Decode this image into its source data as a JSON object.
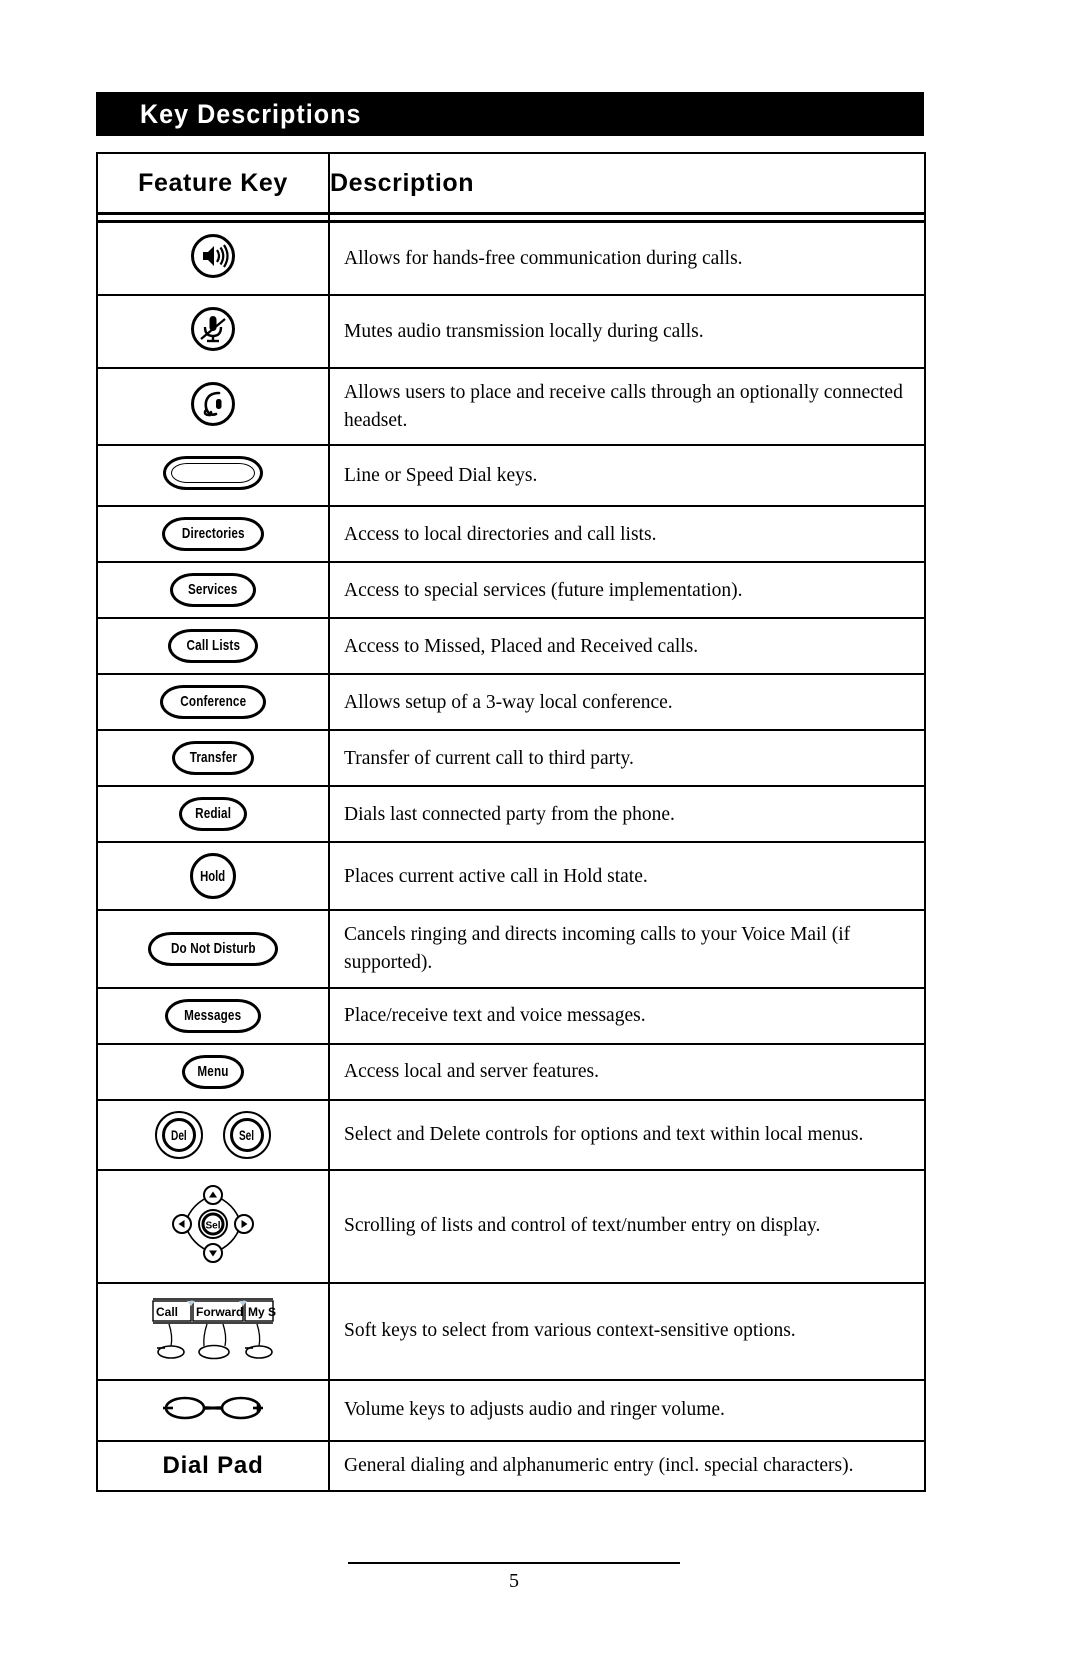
{
  "banner": {
    "title": "Key Descriptions"
  },
  "table": {
    "headers": {
      "feature_key": "Feature Key",
      "description": "Description"
    },
    "rows": [
      {
        "key_type": "icon",
        "icon": "speaker-icon",
        "key_label": "",
        "description": "Allows for hands-free communication during calls."
      },
      {
        "key_type": "icon",
        "icon": "mute-microphone-icon",
        "key_label": "",
        "description": "Mutes audio transmission locally during calls."
      },
      {
        "key_type": "icon",
        "icon": "headset-icon",
        "key_label": "",
        "description": "Allows users to place and receive calls through an optionally connected headset."
      },
      {
        "key_type": "blank-barrel",
        "icon": "line-key-icon",
        "key_label": "",
        "description": "Line or Speed Dial keys."
      },
      {
        "key_type": "barrel",
        "icon": "directories-key-icon",
        "key_label": "Directories",
        "description": "Access to local directories and call lists."
      },
      {
        "key_type": "barrel",
        "icon": "services-key-icon",
        "key_label": "Services",
        "description": "Access to special services (future implementation)."
      },
      {
        "key_type": "barrel",
        "icon": "call-lists-key-icon",
        "key_label": "Call Lists",
        "description": "Access to Missed, Placed and Received calls."
      },
      {
        "key_type": "barrel",
        "icon": "conference-key-icon",
        "key_label": "Conference",
        "description": "Allows setup of a 3-way local conference."
      },
      {
        "key_type": "barrel",
        "icon": "transfer-key-icon",
        "key_label": "Transfer",
        "description": "Transfer of current call to third party."
      },
      {
        "key_type": "barrel",
        "icon": "redial-key-icon",
        "key_label": "Redial",
        "description": "Dials last connected party from the phone."
      },
      {
        "key_type": "circle",
        "icon": "hold-key-icon",
        "key_label": "Hold",
        "description": "Places current active call in Hold state."
      },
      {
        "key_type": "barrel",
        "icon": "do-not-disturb-key-icon",
        "key_label": "Do Not Disturb",
        "description": "Cancels ringing and directs incoming calls to your Voice Mail (if supported)."
      },
      {
        "key_type": "barrel",
        "icon": "messages-key-icon",
        "key_label": "Messages",
        "description": "Place/receive text and voice messages."
      },
      {
        "key_type": "barrel",
        "icon": "menu-key-icon",
        "key_label": "Menu",
        "description": "Access local and server features."
      },
      {
        "key_type": "del-sel",
        "icon": "del-sel-keys-icon",
        "key_label": "Del Sel",
        "del_label": "Del",
        "sel_label": "Sel",
        "description": "Select and Delete controls for options and text within local menus."
      },
      {
        "key_type": "navpad",
        "icon": "navigation-pad-icon",
        "key_label": "Sel",
        "center_label": "Sel",
        "description": "Scrolling of lists and control of text/number entry on display."
      },
      {
        "key_type": "softkeys",
        "icon": "soft-keys-icon",
        "key_label": "",
        "soft_labels": [
          "Call",
          "Forward",
          "My S"
        ],
        "description": "Soft keys to select from various context-sensitive options."
      },
      {
        "key_type": "volume",
        "icon": "volume-rocker-icon",
        "key_label": "",
        "minus": "−",
        "plus": "+",
        "description": "Volume keys to adjusts audio and ringer volume."
      },
      {
        "key_type": "text",
        "icon": "dial-pad-label",
        "key_label": "Dial Pad",
        "description": "General dialing and alphanumeric entry (incl. special characters)."
      }
    ]
  },
  "footer": {
    "page_number": "5"
  },
  "colors": {
    "ink": "#000000",
    "paper": "#ffffff",
    "banner_bg": "#000000",
    "banner_text": "#ffffff",
    "softkey_tab": "#b9d0e0"
  }
}
